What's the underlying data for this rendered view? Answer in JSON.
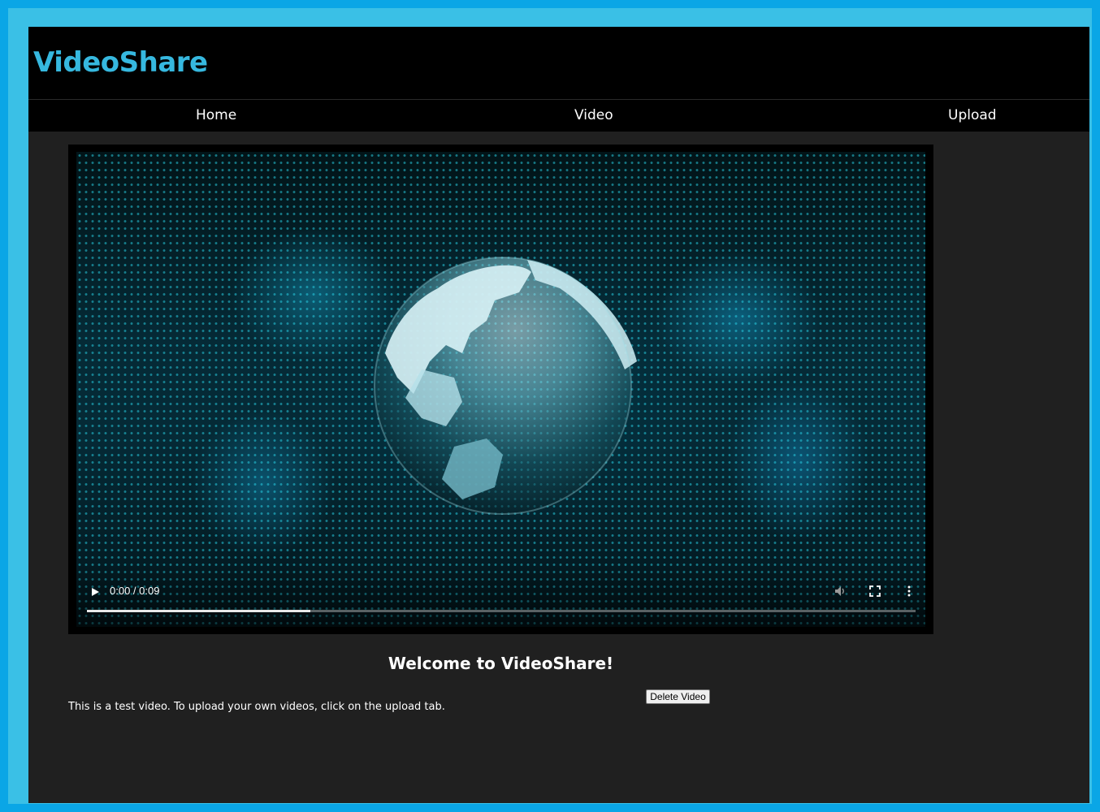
{
  "app": {
    "logo": "VideoShare"
  },
  "nav": {
    "items": [
      {
        "label": "Home"
      },
      {
        "label": "Video"
      },
      {
        "label": "Upload"
      }
    ]
  },
  "player": {
    "time": "0:00 / 0:09",
    "progress_fraction": 0.27,
    "icons": [
      "play-icon",
      "mute-icon",
      "fullscreen-icon",
      "more-options-icon"
    ]
  },
  "main": {
    "welcome": "Welcome to VideoShare!",
    "description": "This is a test video. To upload your own videos, click on the upload tab.",
    "delete_label": "Delete Video"
  },
  "colors": {
    "accent": "#36b8df",
    "frame": "#0aa6e6",
    "header_bg": "#000000",
    "content_bg": "#202020"
  }
}
